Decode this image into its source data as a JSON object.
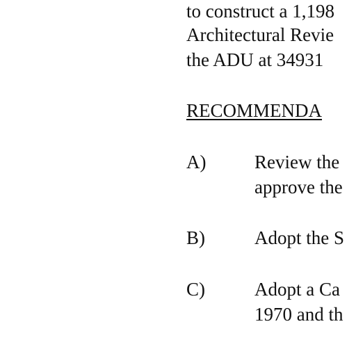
{
  "intro": {
    "line1": "to construct a 1,198",
    "line2": "Architectural Revie",
    "line3": "the ADU at 34931"
  },
  "section": {
    "heading": "RECOMMENDA"
  },
  "items": [
    {
      "letter": "A)",
      "lines": [
        "Review the",
        "approve the"
      ]
    },
    {
      "letter": "B)",
      "lines": [
        "Adopt the S"
      ]
    },
    {
      "letter": "C)",
      "lines": [
        "Adopt a Ca",
        "1970 and th"
      ]
    }
  ]
}
